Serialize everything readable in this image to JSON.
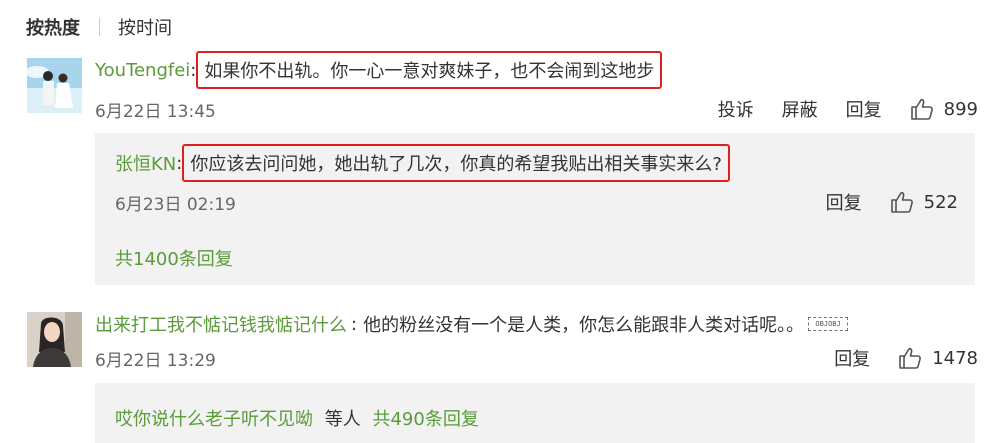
{
  "sort_tabs": {
    "hot": "按热度",
    "time": "按时间"
  },
  "comments": [
    {
      "user": "YouTengfei",
      "text": "如果你不出轨。你一心一意对爽妹子，也不会闹到这地步",
      "time": "6月22日 13:45",
      "actions": {
        "report": "投诉",
        "block": "屏蔽",
        "reply": "回复",
        "likes": "899"
      },
      "reply": {
        "user": "张恒KN",
        "text": "你应该去问问她，她出轨了几次，你真的希望我贴出相关事实来么?",
        "time": "6月23日 02:19",
        "reply_label": "回复",
        "likes": "522"
      },
      "more_replies": "共1400条回复"
    },
    {
      "user": "出来打工我不惦记钱我惦记什么",
      "text": "他的粉丝没有一个是人类，你怎么能跟非人类对话呢。。",
      "emoji": "OBJOBJ",
      "time": "6月22日 13:29",
      "actions": {
        "reply": "回复",
        "likes": "1478"
      },
      "reply_preview": {
        "user": "哎你说什么老子听不见呦",
        "suffix": "等人",
        "count": "共490条回复"
      }
    }
  ],
  "colors": {
    "username": "#5b9b3a",
    "highlight_box": "#e02020",
    "reply_bg": "#f2f2f2"
  }
}
